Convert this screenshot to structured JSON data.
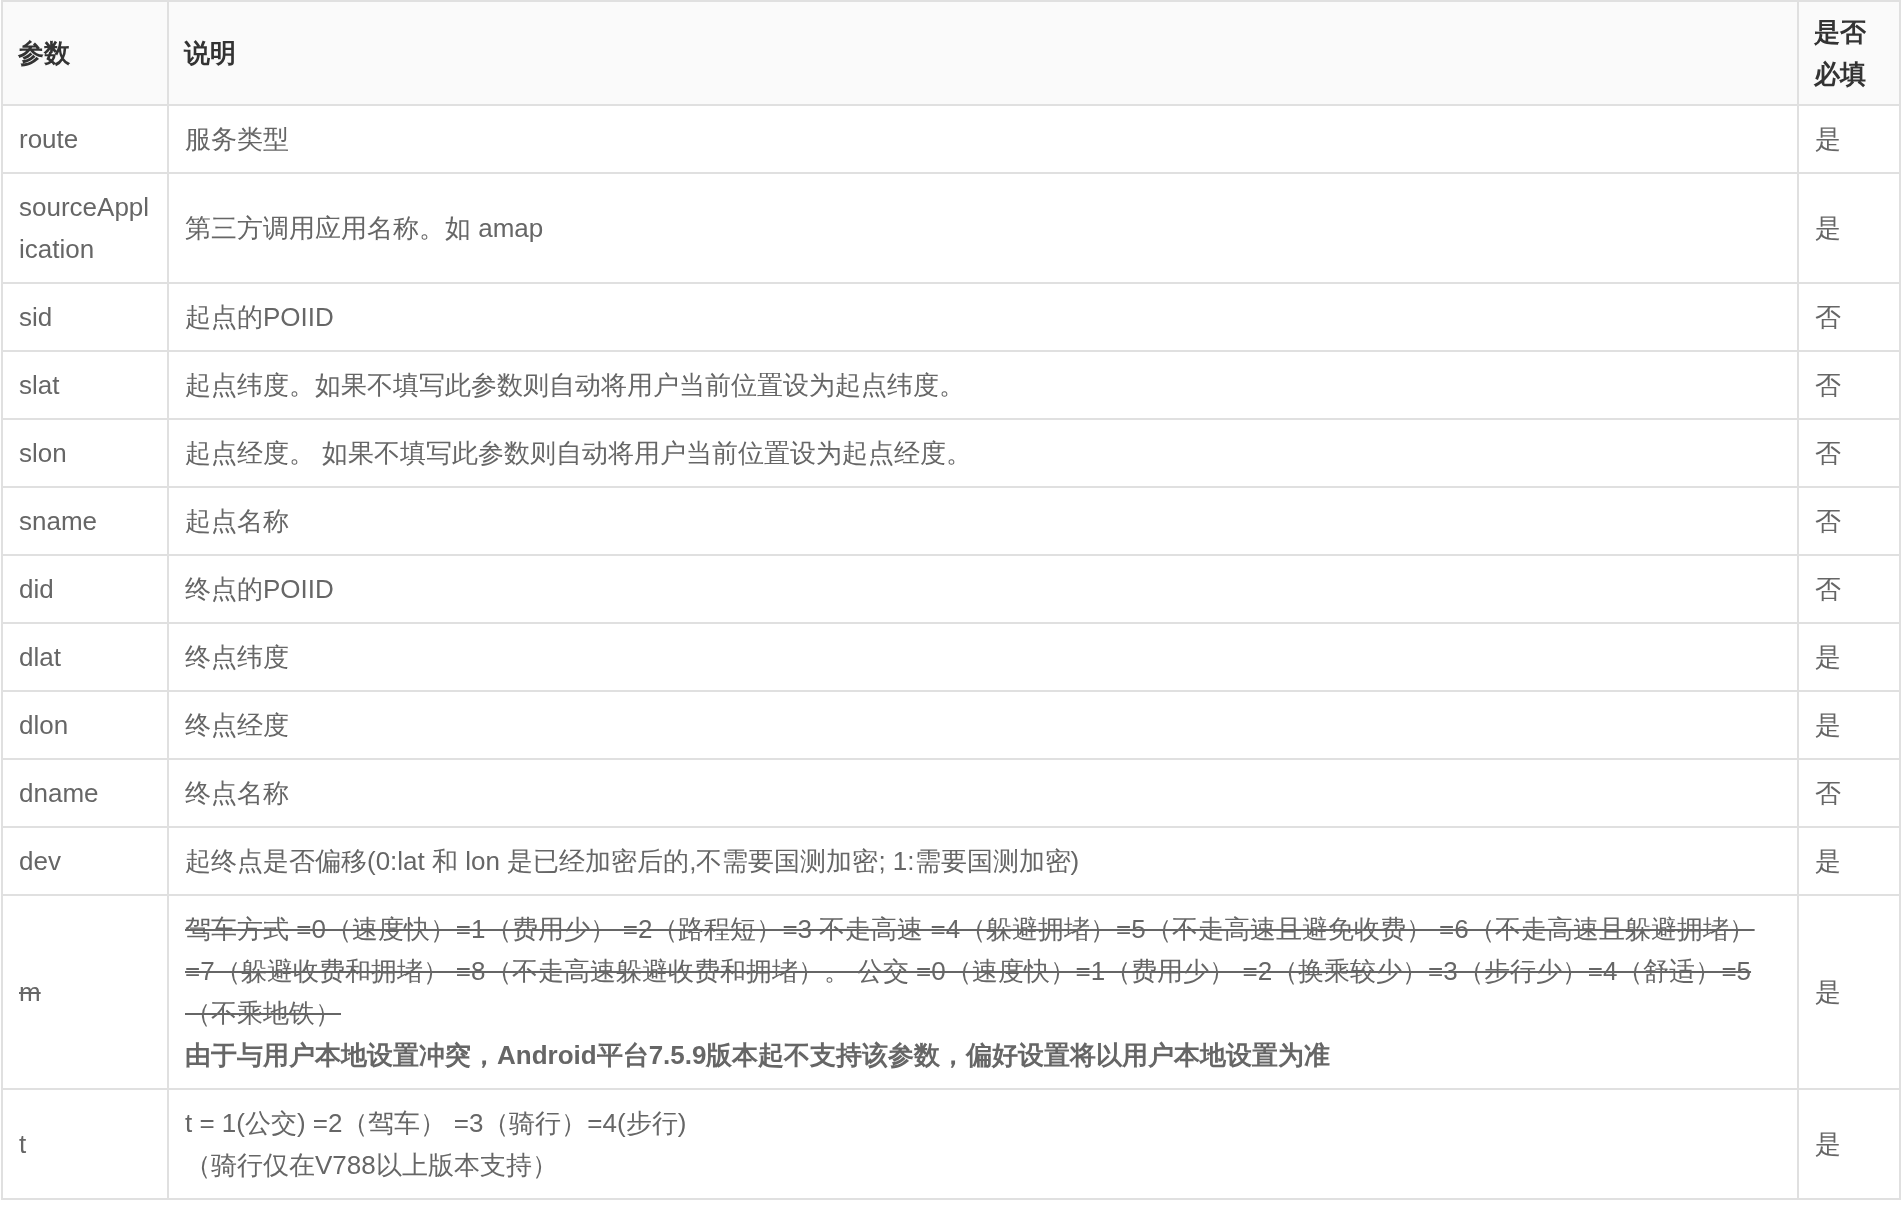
{
  "table": {
    "columns": [
      "参数",
      "说明",
      "是否必填"
    ],
    "rows": [
      {
        "param": "route",
        "struck": false,
        "description": [
          {
            "kind": "plain",
            "text": "服务类型"
          }
        ],
        "required": "是"
      },
      {
        "param": "sourceApplication",
        "struck": false,
        "description": [
          {
            "kind": "plain",
            "text": "第三方调用应用名称。如 amap"
          }
        ],
        "required": "是"
      },
      {
        "param": "sid",
        "struck": false,
        "description": [
          {
            "kind": "plain",
            "text": "起点的POIID"
          }
        ],
        "required": "否"
      },
      {
        "param": "slat",
        "struck": false,
        "description": [
          {
            "kind": "plain",
            "text": "起点纬度。如果不填写此参数则自动将用户当前位置设为起点纬度。"
          }
        ],
        "required": "否"
      },
      {
        "param": "slon",
        "struck": false,
        "description": [
          {
            "kind": "plain",
            "text": "起点经度。 如果不填写此参数则自动将用户当前位置设为起点经度。"
          }
        ],
        "required": "否"
      },
      {
        "param": "sname",
        "struck": false,
        "description": [
          {
            "kind": "plain",
            "text": "起点名称"
          }
        ],
        "required": "否"
      },
      {
        "param": "did",
        "struck": false,
        "description": [
          {
            "kind": "plain",
            "text": "终点的POIID"
          }
        ],
        "required": "否"
      },
      {
        "param": "dlat",
        "struck": false,
        "description": [
          {
            "kind": "plain",
            "text": "终点纬度"
          }
        ],
        "required": "是"
      },
      {
        "param": "dlon",
        "struck": false,
        "description": [
          {
            "kind": "plain",
            "text": "终点经度"
          }
        ],
        "required": "是"
      },
      {
        "param": "dname",
        "struck": false,
        "description": [
          {
            "kind": "plain",
            "text": "终点名称"
          }
        ],
        "required": "否"
      },
      {
        "param": "dev",
        "struck": false,
        "description": [
          {
            "kind": "plain",
            "text": "起终点是否偏移(0:lat 和 lon 是已经加密后的,不需要国测加密; 1:需要国测加密)"
          }
        ],
        "required": "是"
      },
      {
        "param": "m",
        "struck": true,
        "description": [
          {
            "kind": "struck",
            "text": "驾车方式 =0（速度快）=1（费用少） =2（路程短）=3 不走高速 =4（躲避拥堵）=5（不走高速且避免收费） =6（不走高速且躲避拥堵） =7（躲避收费和拥堵） =8（不走高速躲避收费和拥堵）。 公交 =0（速度快）=1（费用少） =2（换乘较少）=3（步行少）=4（舒适）=5（不乘地铁）"
          },
          {
            "kind": "bold",
            "text": "由于与用户本地设置冲突，Android平台7.5.9版本起不支持该参数，偏好设置将以用户本地设置为准"
          }
        ],
        "required": "是"
      },
      {
        "param": "t",
        "struck": false,
        "description": [
          {
            "kind": "plain",
            "text": "t = 1(公交) =2（驾车） =3（骑行）=4(步行)"
          },
          {
            "kind": "plain",
            "text": "（骑行仅在V788以上版本支持）"
          }
        ],
        "required": "是"
      }
    ]
  }
}
